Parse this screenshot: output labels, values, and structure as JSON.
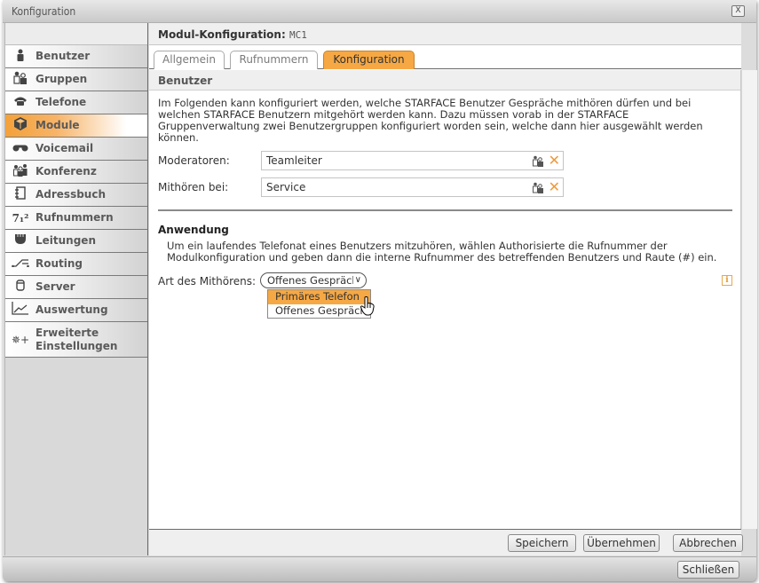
{
  "window": {
    "title": "Konfiguration",
    "close_icon": "close-box-icon"
  },
  "sidebar": {
    "items": [
      {
        "label": "Benutzer",
        "icon": "user-icon",
        "glyph": "♟",
        "active": false
      },
      {
        "label": "Gruppen",
        "icon": "group-icon",
        "glyph": "♟♟",
        "active": false
      },
      {
        "label": "Telefone",
        "icon": "phone-icon",
        "glyph": "☎",
        "active": false
      },
      {
        "label": "Module",
        "icon": "module-cube-icon",
        "glyph": "⬢",
        "active": true
      },
      {
        "label": "Voicemail",
        "icon": "voicemail-icon",
        "glyph": "●●",
        "active": false
      },
      {
        "label": "Konferenz",
        "icon": "conference-icon",
        "glyph": "♟♟",
        "active": false
      },
      {
        "label": "Adressbuch",
        "icon": "addressbook-icon",
        "glyph": "▤",
        "active": false
      },
      {
        "label": "Rufnummern",
        "icon": "numbers-icon",
        "glyph": "7₁²",
        "active": false
      },
      {
        "label": "Leitungen",
        "icon": "lines-plug-icon",
        "glyph": "▼",
        "active": false
      },
      {
        "label": "Routing",
        "icon": "routing-icon",
        "glyph": "╱",
        "active": false
      },
      {
        "label": "Server",
        "icon": "server-icon",
        "glyph": "▯",
        "active": false
      },
      {
        "label": "Auswertung",
        "icon": "chart-icon",
        "glyph": "↗",
        "active": false
      },
      {
        "label": "Erweiterte Einstellungen",
        "icon": "advanced-settings-icon",
        "glyph": "✵+",
        "active": false
      }
    ]
  },
  "header": {
    "label": "Modul-Konfiguration:",
    "value": "MC1"
  },
  "tabs": [
    {
      "label": "Allgemein",
      "active": false
    },
    {
      "label": "Rufnummern",
      "active": false
    },
    {
      "label": "Konfiguration",
      "active": true
    }
  ],
  "section": {
    "title": "Benutzer",
    "description": "Im Folgenden kann konfiguriert werden, welche STARFACE Benutzer Gespräche mithören dürfen und bei welchen STARFACE Benutzern mitgehört werden kann. Dazu müssen vorab in der STARFACE Gruppenverwaltung zwei Benutzergruppen konfiguriert worden sein, welche dann hier ausgewählt werden können.",
    "fields": [
      {
        "label": "Moderatoren:",
        "value": "Teamleiter"
      },
      {
        "label": "Mithören bei:",
        "value": "Service"
      }
    ]
  },
  "anwendung": {
    "title": "Anwendung",
    "text": "Um ein laufendes Telefonat eines Benutzers mitzuhören, wählen Authorisierte die Rufnummer der Modulkonfiguration und geben dann die interne Rufnummer des betreffenden Benutzers und Raute (#) ein."
  },
  "mode": {
    "label": "Art des Mithörens:",
    "selected": "Offenes Gespräch",
    "options": [
      "Primäres Telefon",
      "Offenes Gespräch"
    ],
    "highlighted_option": "Primäres Telefon",
    "info_glyph": "i"
  },
  "footer": {
    "save": "Speichern",
    "apply": "Übernehmen",
    "cancel": "Abbrechen"
  },
  "bottombar": {
    "close": "Schließen"
  },
  "colors": {
    "accent": "#f6a844",
    "clear_icon": "#ef9a3c"
  }
}
